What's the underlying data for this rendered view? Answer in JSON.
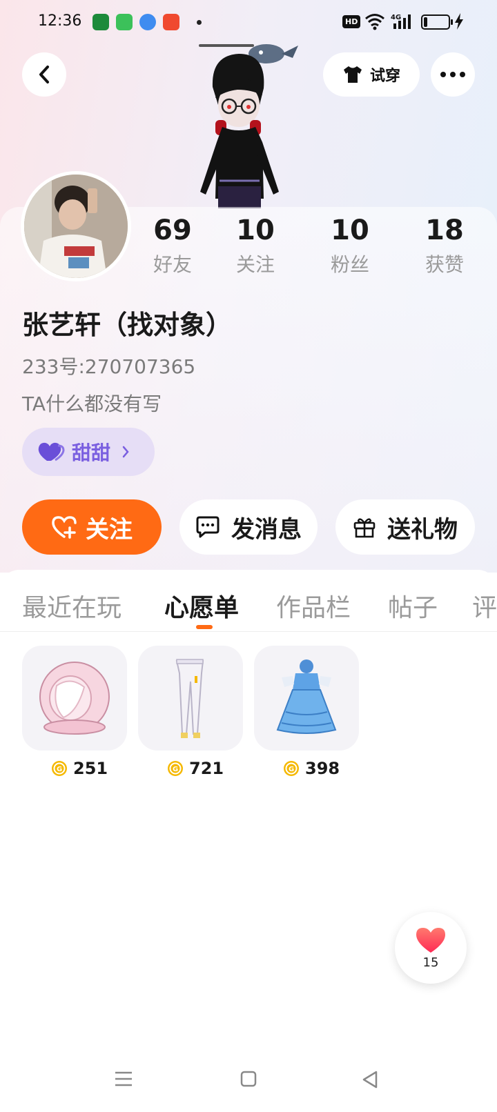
{
  "status_bar": {
    "time": "12:36",
    "hd": "HD",
    "network": "4G",
    "icons": [
      "app-icon-store",
      "app-icon-green",
      "app-icon-blue",
      "app-icon-video",
      "signal-icon",
      "wifi-icon",
      "battery-icon",
      "charging-icon"
    ]
  },
  "header": {
    "tryon_label": "试穿",
    "icons": [
      "back-icon",
      "tshirt-icon",
      "more-icon"
    ]
  },
  "profile": {
    "name": "张艺轩（找对象）",
    "id_text": "233号:270707365",
    "bio": "TA什么都没有写",
    "tag_label": "甜甜",
    "stats": [
      {
        "value": "69",
        "label": "好友"
      },
      {
        "value": "10",
        "label": "关注"
      },
      {
        "value": "10",
        "label": "粉丝"
      },
      {
        "value": "18",
        "label": "获赞"
      }
    ]
  },
  "actions": {
    "follow": "关注",
    "message": "发消息",
    "gift": "送礼物"
  },
  "tabs": [
    {
      "label": "最近在玩",
      "active": false
    },
    {
      "label": "心愿单",
      "active": true
    },
    {
      "label": "作品栏",
      "active": false
    },
    {
      "label": "帖子",
      "active": false
    },
    {
      "label": "评",
      "active": false
    }
  ],
  "wishlist": [
    {
      "item": "pink-helmet",
      "price": "251"
    },
    {
      "item": "white-pants",
      "price": "721"
    },
    {
      "item": "blue-dress",
      "price": "398"
    }
  ],
  "like": {
    "count": "15"
  },
  "colors": {
    "accent": "#ff6a14",
    "tag_bg": "#e6def6",
    "tag_text": "#7a5fe0",
    "coin": "#f5b800",
    "heart": "#ff4d5e"
  }
}
